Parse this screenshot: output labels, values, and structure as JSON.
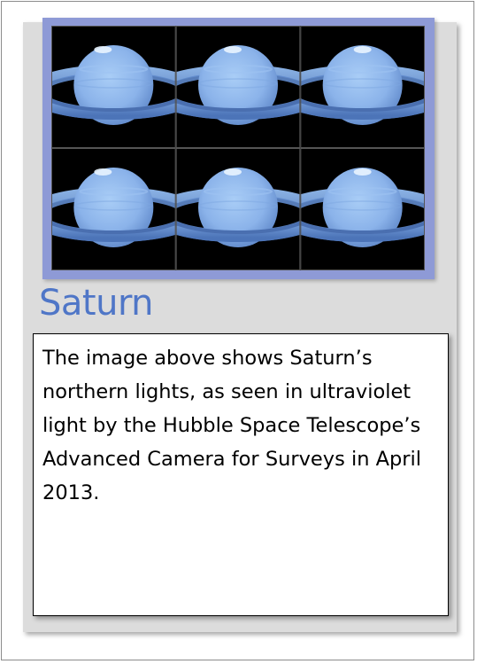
{
  "title": "Saturn",
  "description": "The image above shows Saturn’s northern lights, as seen in ultraviolet light by the Hubble Space Telescope’s Advanced Camera for Surveys in April 2013.",
  "image": {
    "subject": "saturn-ultraviolet-aurora-mosaic",
    "rows": 2,
    "cols": 3,
    "frame_color": "#8e9ad6",
    "planet_color": "#8fb7ec",
    "ring_color": "#6f99d8",
    "background_color": "#000000"
  },
  "colors": {
    "title": "#4f76c7",
    "card_background": "#dcdcdc",
    "text": "#000000"
  }
}
